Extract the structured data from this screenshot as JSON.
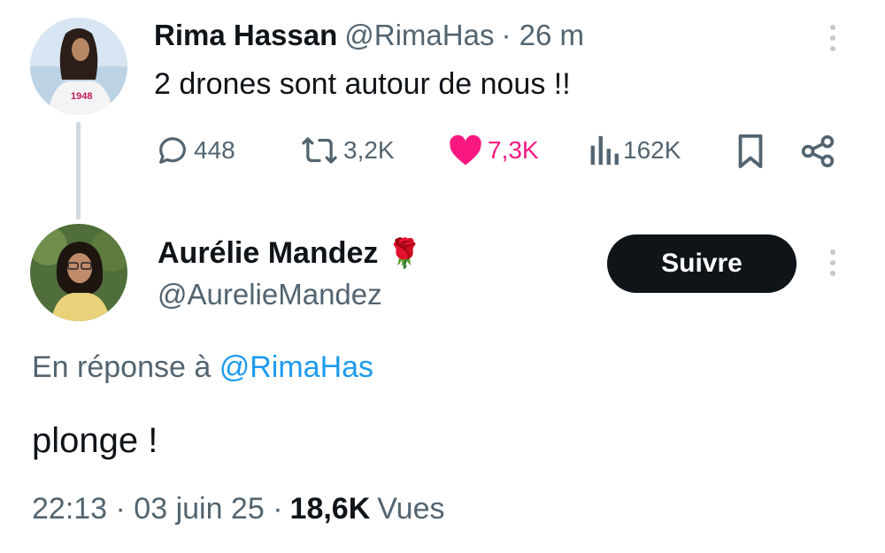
{
  "parent_tweet": {
    "author_name": "Rima Hassan",
    "handle": "@RimaHas",
    "time": "· 26 m",
    "text": "2 drones sont autour de nous !!",
    "avatar_shirt_text": "1948",
    "stats": {
      "replies": "448",
      "reposts": "3,2K",
      "likes": "7,3K",
      "views": "162K"
    }
  },
  "reply_tweet": {
    "author_name": "Aurélie Mandez",
    "name_emoji": "🌹",
    "handle": "@AurelieMandez",
    "follow_label": "Suivre",
    "reply_prefix": "En réponse à",
    "reply_handle": "@RimaHas",
    "text": "plonge !",
    "timestamp": "22:13 · 03 juin 25 ·",
    "views_count": "18,6K",
    "views_label": "Vues"
  },
  "colors": {
    "like": "#f91880",
    "link": "#1d9bf0",
    "muted": "#536471",
    "text": "#0f1419",
    "thread_line": "#cfd9de"
  },
  "icons": [
    "reply-icon",
    "repost-icon",
    "heart-icon",
    "views-icon",
    "bookmark-icon",
    "share-icon",
    "more-icon",
    "rose-emoji-icon"
  ]
}
